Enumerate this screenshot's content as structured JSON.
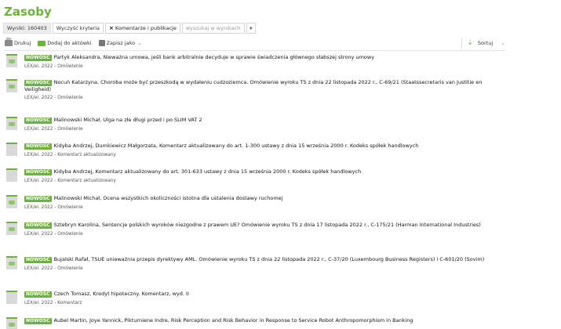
{
  "page": {
    "title": "Zasoby"
  },
  "filters": {
    "results_label": "Wyniki: 160403",
    "clear_label": "Wyczyść kryteria",
    "chip_label": "Komentarze i publikacje",
    "search_placeholder": "wyszukaj w wynikach",
    "add_label": "+"
  },
  "toolbar": {
    "print_label": "Drukuj",
    "folder_label": "Dodaj do aktówki",
    "save_label": "Zapisz jako",
    "sort_label": "Sortuj"
  },
  "badge_label": "NOWOŚĆ",
  "results": [
    {
      "title": "Partyk Aleksandra, Nieważna umowa, jeśli bank arbitralnie decyduje w sprawie świadczenia głównego słabszej strony umowy",
      "meta": "LEX/el. 2022 - Omówienie",
      "icon": "comment"
    },
    {
      "title": "Nocuń Katarzyna, Choroba może być przeszkodą w wydaleniu cudzoziemca. Omówienie wyroku TS z dnia 22 listopada 2022 r., C-69/21 (Staatssecretaris van Justitie en Veiligheid)",
      "meta": "LEX/el. 2022 - Omówienie",
      "icon": "comment"
    },
    {
      "title": "Malinowski Michał, Ulga na złe długi przed i po SLIM VAT 2",
      "meta": "LEX/el. 2022 - Omówienie",
      "icon": "comment"
    },
    {
      "title": "Kidyba Andrzej, Dumkiewicz Małgorzata, Komentarz aktualizowany do art. 1-300 ustawy z dnia 15 września 2000 r. Kodeks spółek handlowych",
      "meta": "LEX/el. 2022 - Komentarz aktualizowany",
      "icon": "plain"
    },
    {
      "title": "Kidyba Andrzej, Komentarz aktualizowany do art. 301-633 ustawy z dnia 15 września 2000 r. Kodeks spółek handlowych",
      "meta": "LEX/el. 2022 - Komentarz aktualizowany",
      "icon": "plain"
    },
    {
      "title": "Malinowski Michał, Ocena wszystkich okoliczności istotna dla ustalenia dostawy ruchomej",
      "meta": "LEX/el. 2022 - Omówienie",
      "icon": "comment"
    },
    {
      "title": "Sztebryn Karolina, Sentencje polskich wyroków niezgodne z prawem UE? Omówienie wyroku TS z dnia 17 listopada 2022 r., C-175/21 (Harman International Industries)",
      "meta": "LEX/el. 2022 - Omówienie",
      "icon": "comment"
    },
    {
      "title": "Bujalski Rafał, TSUE unieważnia przepis dyrektywy AML. Omówienie wyroku TS z dnia 22 listopada 2022 r., C-37/20 (Luxembourg Business Registers) i C-601/20 (Sovim)",
      "meta": "LEX/el. 2022 - Omówienie",
      "icon": "comment"
    },
    {
      "title": "Czech Tomasz, Kredyt hipoteczny. Komentarz, wyd. II",
      "meta": "LEX/el. 2022 - Komentarz",
      "icon": "plain"
    },
    {
      "title": "Aubel Martin, Joye Yannick, Pikturniene Indre, Risk Perception and Risk Behavior in Response to Service Robot Anthropomorphism in Banking",
      "meta": "",
      "icon": "comment"
    }
  ]
}
